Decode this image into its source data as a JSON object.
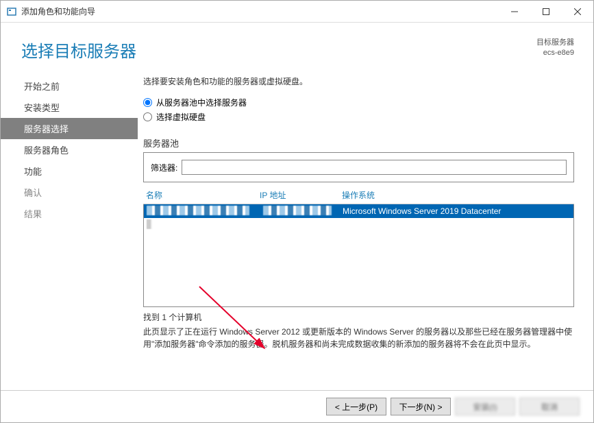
{
  "window": {
    "title": "添加角色和功能向导"
  },
  "header": {
    "page_title": "选择目标服务器",
    "target_label": "目标服务器",
    "target_name": "ecs-e8e9"
  },
  "sidebar": {
    "items": [
      {
        "label": "开始之前",
        "enabled": true,
        "active": false
      },
      {
        "label": "安装类型",
        "enabled": true,
        "active": false
      },
      {
        "label": "服务器选择",
        "enabled": true,
        "active": true
      },
      {
        "label": "服务器角色",
        "enabled": true,
        "active": false
      },
      {
        "label": "功能",
        "enabled": true,
        "active": false
      },
      {
        "label": "确认",
        "enabled": false,
        "active": false
      },
      {
        "label": "结果",
        "enabled": false,
        "active": false
      }
    ]
  },
  "main": {
    "instruction": "选择要安装角色和功能的服务器或虚拟硬盘。",
    "radio_pool": "从服务器池中选择服务器",
    "radio_vhd": "选择虚拟硬盘",
    "pool_label": "服务器池",
    "filter_label": "筛选器:",
    "filter_value": "",
    "columns": {
      "name": "名称",
      "ip": "IP 地址",
      "os": "操作系统"
    },
    "rows": [
      {
        "name": "",
        "ip": "",
        "os": "Microsoft Windows Server 2019 Datacenter",
        "selected": true
      }
    ],
    "count": "找到 1 个计算机",
    "description": "此页显示了正在运行 Windows Server 2012 或更新版本的 Windows Server 的服务器以及那些已经在服务器管理器中使用\"添加服务器\"命令添加的服务器。脱机服务器和尚未完成数据收集的新添加的服务器将不会在此页中显示。"
  },
  "footer": {
    "prev": "< 上一步(P)",
    "next": "下一步(N) >",
    "install": "安装(I)",
    "cancel": "取消"
  }
}
